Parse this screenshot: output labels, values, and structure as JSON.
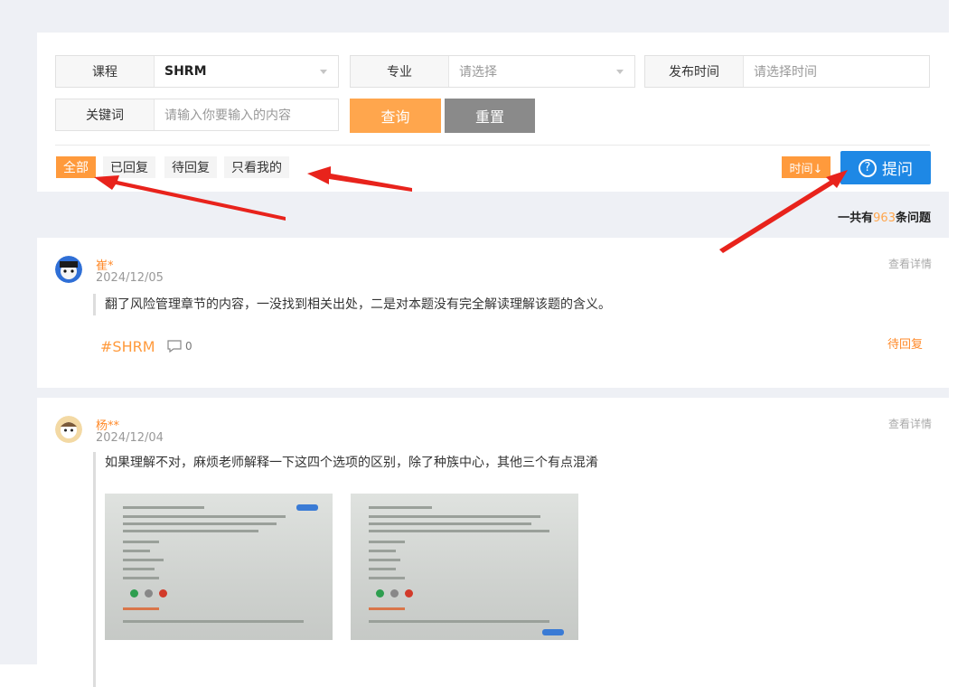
{
  "filters": {
    "course": {
      "label": "课程",
      "value": "SHRM"
    },
    "major": {
      "label": "专业",
      "placeholder": "请选择"
    },
    "publish_time": {
      "label": "发布时间",
      "placeholder": "请选择时间"
    },
    "keyword": {
      "label": "关键词",
      "placeholder": "请输入你要输入的内容"
    },
    "query_label": "查询",
    "reset_label": "重置"
  },
  "tabs": [
    {
      "label": "全部",
      "active": true
    },
    {
      "label": "已回复",
      "active": false
    },
    {
      "label": "待回复",
      "active": false
    },
    {
      "label": "只看我的",
      "active": false
    }
  ],
  "sort": {
    "label": "时间↓"
  },
  "ask": {
    "label": "提问",
    "icon": "question-circle-icon"
  },
  "total": {
    "prefix": "一共有",
    "count": "963",
    "suffix": "条问题"
  },
  "posts": [
    {
      "user": "崔*",
      "date": "2024/12/05",
      "detail_label": "查看详情",
      "content": "翻了风险管理章节的内容，一没找到相关出处，二是对本题没有完全解读理解该题的含义。",
      "tag": "#SHRM",
      "comments": "0",
      "status": "待回复"
    },
    {
      "user": "杨**",
      "date": "2024/12/04",
      "detail_label": "查看详情",
      "content": "如果理解不对，麻烦老师解释一下这四个选项的区别，除了种族中心，其他三个有点混淆"
    }
  ],
  "colors": {
    "accent": "#ff9a3c",
    "primary": "#1e88e5",
    "reset": "#8a8a8a",
    "annotation": "#e8231c"
  }
}
